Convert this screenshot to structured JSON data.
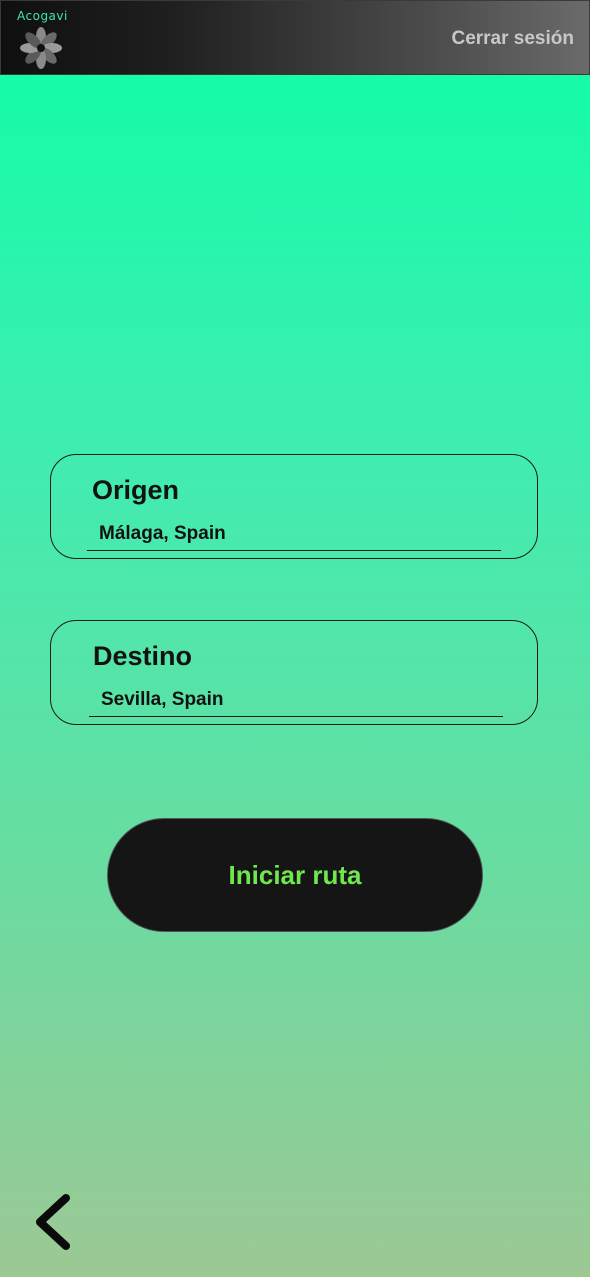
{
  "header": {
    "brand_name": "Acogavi",
    "logo_icon": "flower-logo-icon",
    "logout_label": "Cerrar sesión"
  },
  "form": {
    "origin": {
      "label": "Origen",
      "value": "Málaga, Spain"
    },
    "destination": {
      "label": "Destino",
      "value": "Sevilla, Spain"
    },
    "start_button_label": "Iniciar ruta"
  },
  "navigation": {
    "back_icon": "chevron-left-icon"
  },
  "colors": {
    "background_top": "#0dffa6",
    "background_bottom": "#9cc894",
    "button_bg": "#161515",
    "button_text": "#6fe84f",
    "brand_text": "#3ee6a8",
    "logout_text": "#c8c8c8"
  }
}
